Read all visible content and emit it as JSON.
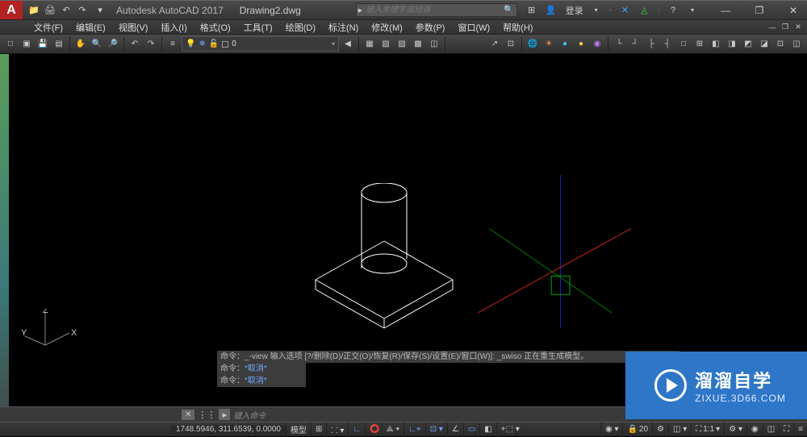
{
  "title": {
    "app": "Autodesk AutoCAD 2017",
    "file": "Drawing2.dwg"
  },
  "search": {
    "placeholder": "键入关键字或短语"
  },
  "user": {
    "login_label": "登录"
  },
  "window_controls": {
    "min": "—",
    "max": "❐",
    "close": "✕"
  },
  "menu": {
    "items": [
      "文件(F)",
      "编辑(E)",
      "视图(V)",
      "插入(I)",
      "格式(O)",
      "工具(T)",
      "绘图(D)",
      "标注(N)",
      "修改(M)",
      "参数(P)",
      "窗口(W)",
      "帮助(H)"
    ]
  },
  "layer": {
    "name": "0"
  },
  "command": {
    "line1_prefix": "命令：",
    "line1_body": "_-view 输入选项 [?/删除(D)/正交(O)/恢复(R)/保存(S)/设置(E)/窗口(W)]:  _swiso 正在重生成模型。",
    "line2_prefix": "命令：",
    "line2_body": "*取消*",
    "line3_prefix": "命令：",
    "line3_body": "*取消*",
    "prompt_placeholder": "键入命令"
  },
  "status": {
    "coord": "1748.5946, 311.6539, 0.0000",
    "model": "模型",
    "scale": "1:1",
    "anno": "20"
  },
  "ucs": {
    "x": "X",
    "y": "Y",
    "z": "Z"
  },
  "watermark": {
    "name": "溜溜自学",
    "url": "ZIXUE.3D66.COM"
  },
  "icons": {
    "qat": [
      "📁",
      "🖨",
      "↶",
      "↷"
    ],
    "title_right": [
      "⊞◦",
      "",
      "✕",
      "?"
    ],
    "toolbar_left": [
      "□",
      "▣",
      "▢",
      "▤",
      "🔍",
      "🔎",
      "↶",
      "↷",
      "🔒",
      "🔓",
      "⊞"
    ],
    "toolbar_right": [
      "🌐",
      "◉",
      "●",
      "◐",
      "◑",
      "◎",
      "◉",
      "│",
      "└",
      "┘",
      "├",
      "□",
      "⊞",
      "▭",
      "◧",
      "◨",
      "□",
      "⊡",
      "◫"
    ]
  }
}
